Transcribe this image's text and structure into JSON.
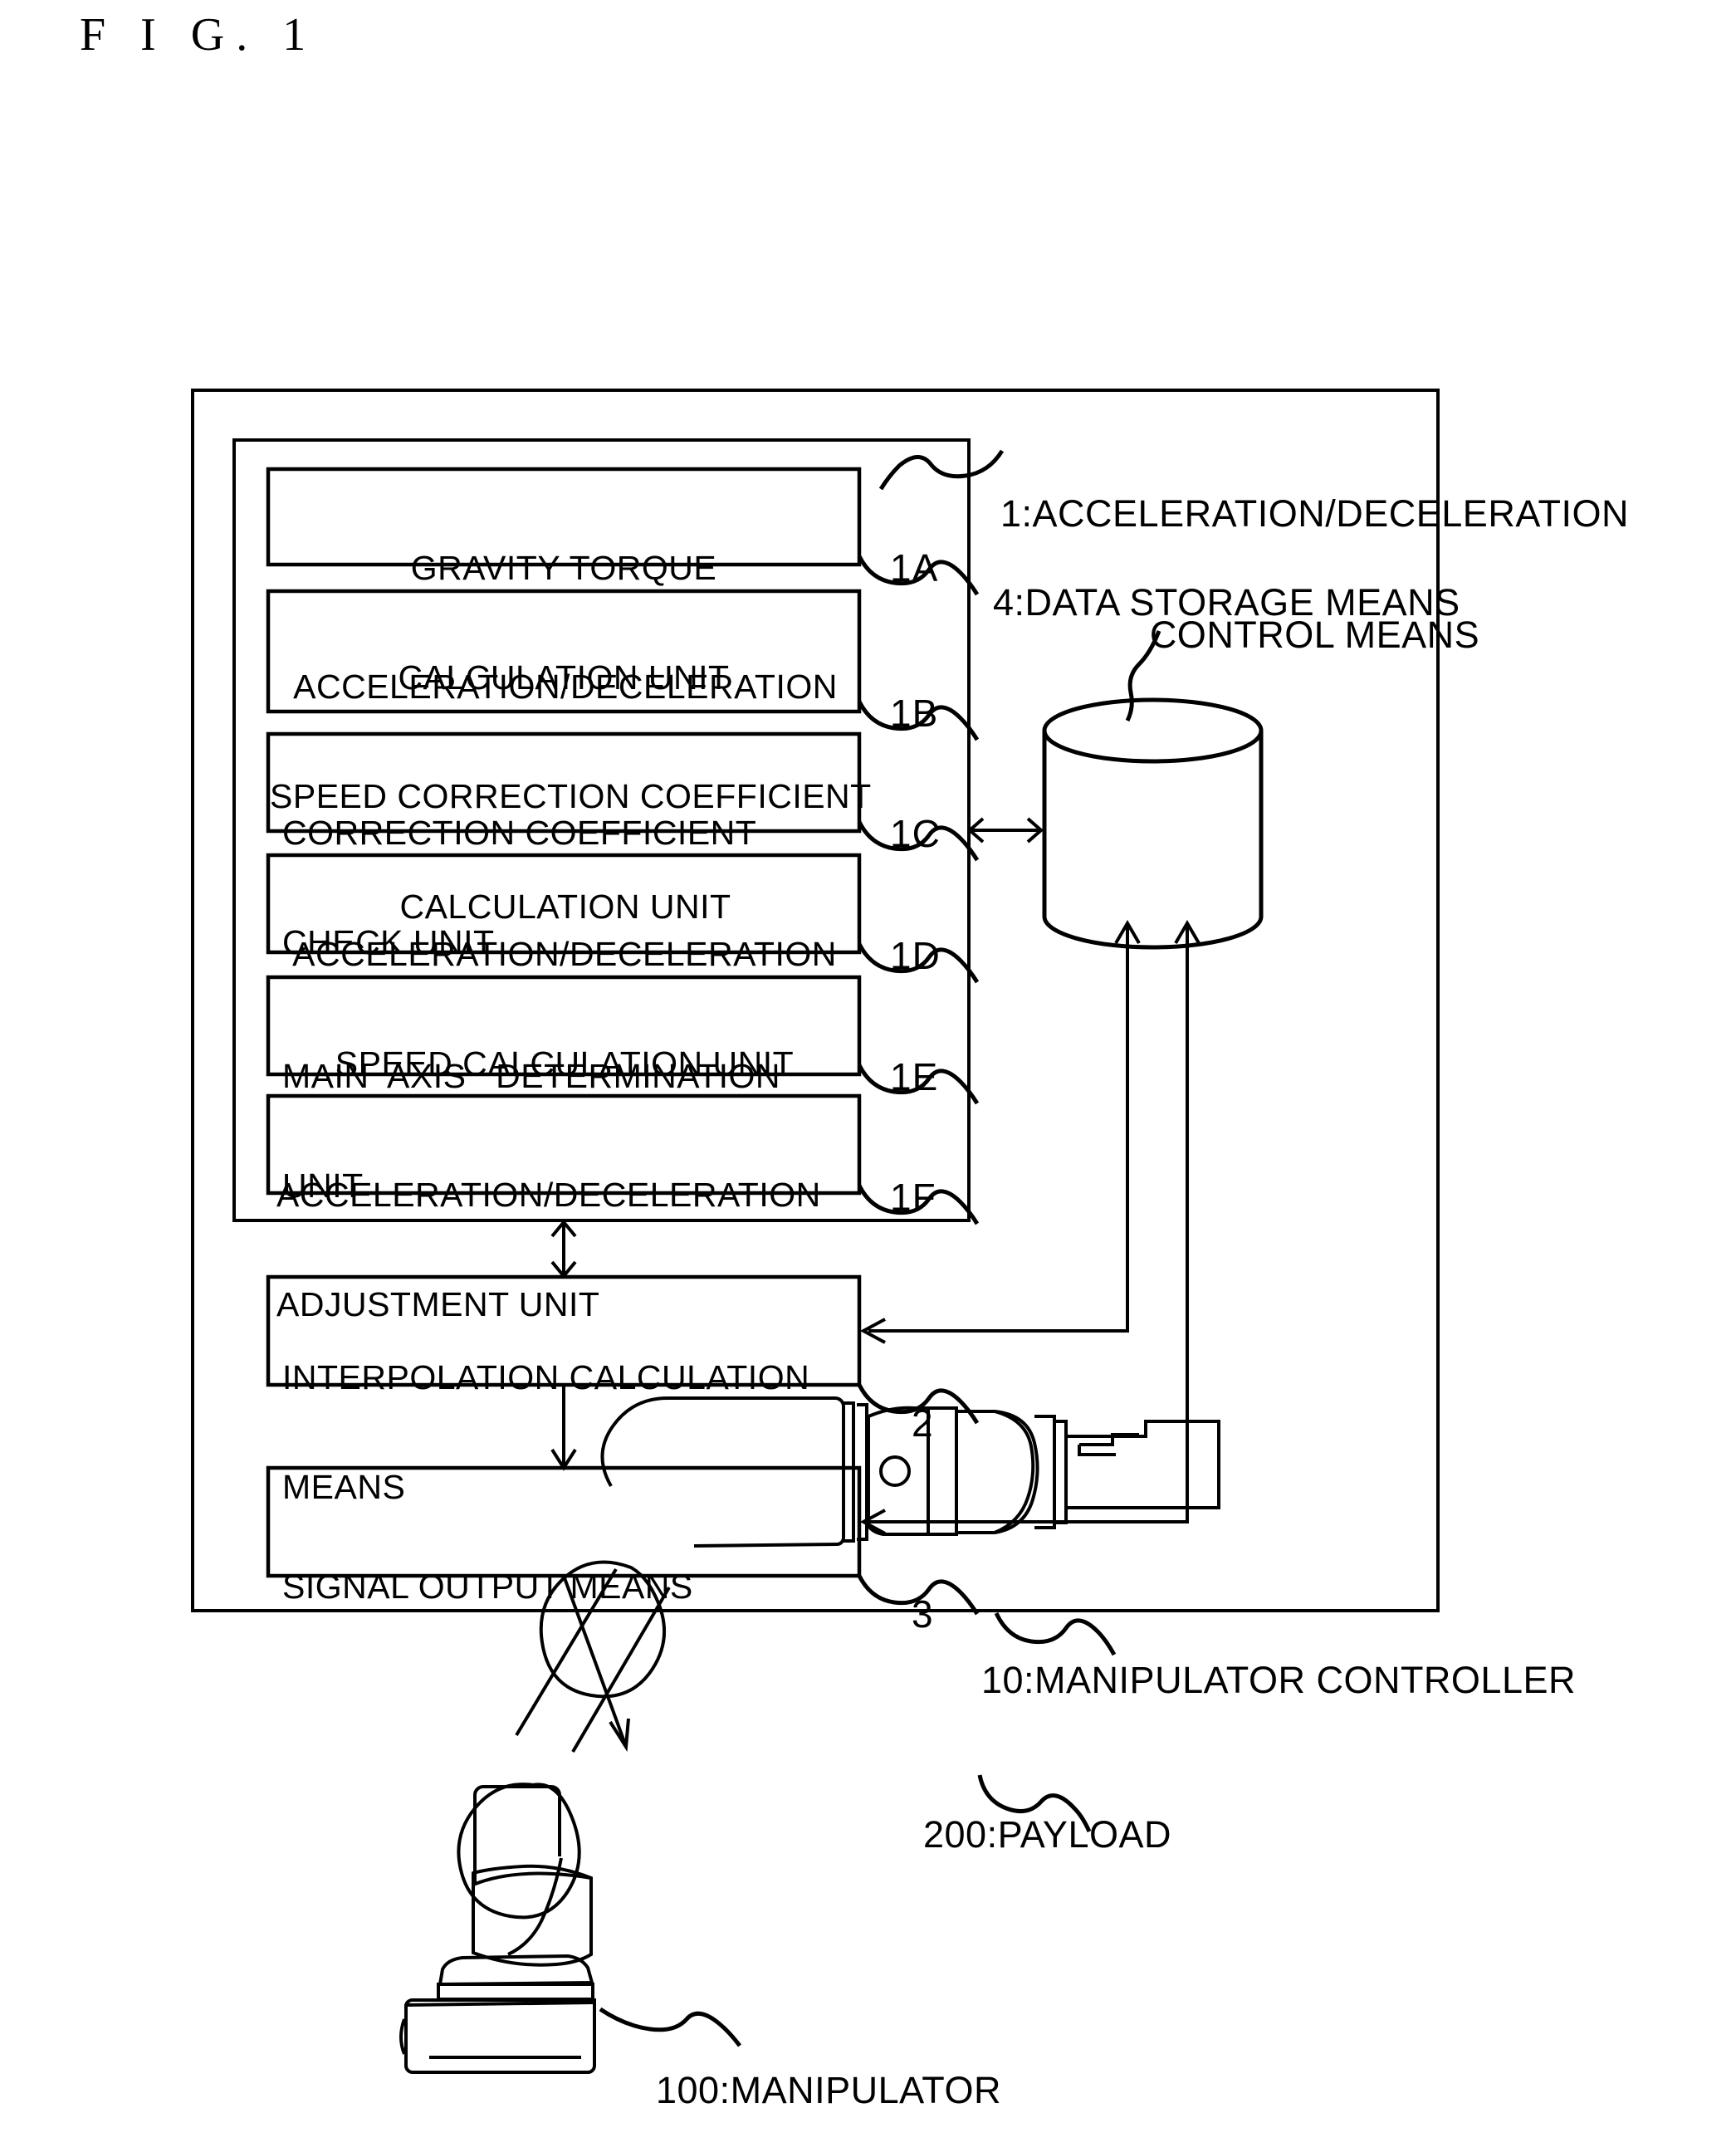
{
  "figure": {
    "title": "F I G. 1"
  },
  "controller": {
    "label": "10:MANIPULATOR CONTROLLER"
  },
  "control_means": {
    "label_line1": "1:ACCELERATION/DECELERATION",
    "label_line2": "CONTROL MEANS"
  },
  "storage": {
    "label": "4:DATA STORAGE MEANS",
    "shape": "cylinder"
  },
  "units": [
    {
      "ref": "1A",
      "align": "center",
      "lines": [
        "GRAVITY TORQUE",
        "CALCULATION UNIT"
      ]
    },
    {
      "ref": "1B",
      "align": "center",
      "lines": [
        "ACCELERATION/DECELERATION",
        "SPEED CORRECTION COEFFICIENT",
        "CALCULATION UNIT"
      ]
    },
    {
      "ref": "1C",
      "align": "left",
      "lines": [
        "CORRECTION COEFFICIENT",
        "CHECK UNIT"
      ]
    },
    {
      "ref": "1D",
      "align": "center",
      "lines": [
        "ACCELERATION/DECELERATION",
        "SPEED CALCULATION UNIT"
      ]
    },
    {
      "ref": "1E",
      "align": "left",
      "lines": [
        "MAIN  AXIS   DETERMINATION",
        "UNIT"
      ]
    },
    {
      "ref": "1F",
      "align": "left",
      "lines": [
        "ACCELERATION/DECELERATION",
        "ADJUSTMENT UNIT"
      ]
    }
  ],
  "blocks": [
    {
      "ref": "2",
      "align": "left",
      "lines": [
        "INTERPOLATION CALCULATION",
        "MEANS"
      ]
    },
    {
      "ref": "3",
      "align": "left",
      "lines": [
        "SIGNAL OUTPUT MEANS"
      ]
    }
  ],
  "manipulator": {
    "label": "100:MANIPULATOR"
  },
  "payload": {
    "label": "200:PAYLOAD"
  },
  "colors": {
    "stroke": "#000000",
    "background": "#ffffff"
  }
}
